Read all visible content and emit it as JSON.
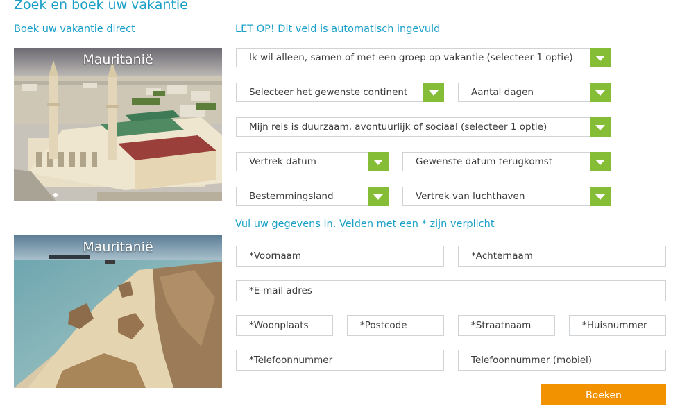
{
  "header": {
    "title": "Zoek en boek uw vakantie"
  },
  "left": {
    "label": "Boek uw vakantie direct",
    "photos": [
      {
        "caption": "Mauritanië",
        "icon": "mosque-photo"
      },
      {
        "caption": "Mauritanië",
        "icon": "coast-photo"
      }
    ]
  },
  "trip": {
    "notice": "LET OP! Dit veld is automatisch ingevuld",
    "travel_party": "Ik wil alleen, samen of met een groep op vakantie (selecteer 1 optie)",
    "continent": "Selecteer het gewenste continent",
    "days": "Aantal dagen",
    "trip_style": "Mijn reis is duurzaam, avontuurlijk of sociaal (selecteer 1 optie)",
    "departure_date": "Vertrek datum",
    "return_date": "Gewenste datum terugkomst",
    "destination": "Bestemmingsland",
    "airport": "Vertrek van luchthaven"
  },
  "contact": {
    "label": "Vul uw gegevens in. Velden met een * zijn verplicht",
    "first_name": "*Voornaam",
    "last_name": "*Achternaam",
    "email": "*E-mail adres",
    "city": "*Woonplaats",
    "postcode": "*Postcode",
    "street": "*Straatnaam",
    "house_number": "*Huisnummer",
    "phone": "*Telefoonnummer",
    "mobile": "Telefoonnummer (mobiel)"
  },
  "submit": {
    "label": "Boeken"
  },
  "colors": {
    "accent_text": "#1aa0c8",
    "dropdown_arrow": "#86bd37",
    "submit": "#f39200"
  }
}
